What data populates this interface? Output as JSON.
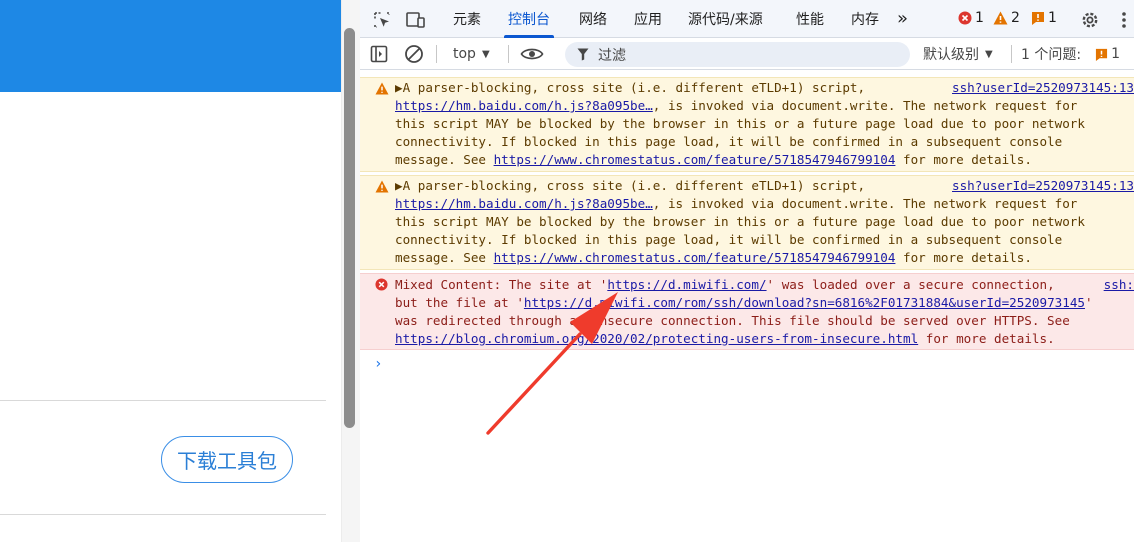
{
  "left_page": {
    "download_button": "下载工具包"
  },
  "devtools": {
    "tabs": [
      "元素",
      "控制台",
      "网络",
      "应用",
      "源代码/来源",
      "性能",
      "内存"
    ],
    "active_tab": "控制台",
    "more_tabs": "»",
    "counts": {
      "errors": "1",
      "warnings": "2",
      "issues": "1"
    },
    "toolbar": {
      "context": "top",
      "filter_placeholder": "过滤",
      "level": "默认级别",
      "issues_label": "1 个问题:",
      "issues_count": "1"
    },
    "messages": [
      {
        "type": "warning",
        "source": "ssh?userId=2520973145:13",
        "lines": [
          "▶A parser-blocking, cross site (i.e. different eTLD+1) script,",
          "https://hm.baidu.com/h.js?8a095be…, is invoked via document.write. The network request for",
          "this script MAY be blocked by the browser in this or a future page load due to poor network",
          "connectivity. If blocked in this page load, it will be confirmed in a subsequent console",
          "message. See https://www.chromestatus.com/feature/5718547946799104 for more details."
        ],
        "link1": "https://hm.baidu.com/h.js?8a095be…",
        "link2": "https://www.chromestatus.com/feature/5718547946799104"
      },
      {
        "type": "warning",
        "source": "ssh?userId=2520973145:13",
        "lines": [
          "▶A parser-blocking, cross site (i.e. different eTLD+1) script,",
          "https://hm.baidu.com/h.js?8a095be…, is invoked via document.write. The network request for",
          "this script MAY be blocked by the browser in this or a future page load due to poor network",
          "connectivity. If blocked in this page load, it will be confirmed in a subsequent console",
          "message. See https://www.chromestatus.com/feature/5718547946799104 for more details."
        ],
        "link1": "https://hm.baidu.com/h.js?8a095be…",
        "link2": "https://www.chromestatus.com/feature/5718547946799104"
      },
      {
        "type": "error",
        "source": "ssh:",
        "lines": [
          "Mixed Content: The site at 'https://d.miwifi.com/' was loaded over a secure connection,",
          "but the file at 'https://d.miwifi.com/rom/ssh/download?sn=6816%2F01731884&userId=2520973145'",
          "was redirected through an insecure connection. This file should be served over HTTPS. See",
          "https://blog.chromium.org/2020/02/protecting-users-from-insecure.html for more details."
        ]
      }
    ],
    "prompt": "›"
  },
  "colors": {
    "accent": "#0b57d0",
    "header_blue": "#1e88e5",
    "annotation_arrow": "#ef3b2c"
  }
}
